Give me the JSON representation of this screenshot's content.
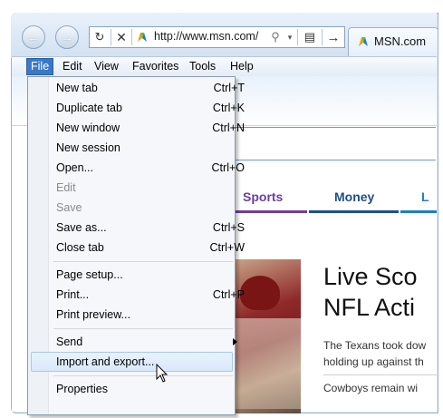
{
  "browser": {
    "url": "http://www.msn.com/",
    "tab_title": "MSN.com"
  },
  "menubar": {
    "items": [
      "File",
      "Edit",
      "View",
      "Favorites",
      "Tools",
      "Help"
    ]
  },
  "file_menu": {
    "items": [
      {
        "label": "New tab",
        "shortcut": "Ctrl+T",
        "enabled": true
      },
      {
        "label": "Duplicate tab",
        "shortcut": "Ctrl+K",
        "enabled": true
      },
      {
        "label": "New window",
        "shortcut": "Ctrl+N",
        "enabled": true
      },
      {
        "label": "New session",
        "shortcut": "",
        "enabled": true
      },
      {
        "label": "Open...",
        "shortcut": "Ctrl+O",
        "enabled": true
      },
      {
        "label": "Edit",
        "shortcut": "",
        "enabled": false
      },
      {
        "label": "Save",
        "shortcut": "",
        "enabled": false
      },
      {
        "label": "Save as...",
        "shortcut": "Ctrl+S",
        "enabled": true
      },
      {
        "label": "Close tab",
        "shortcut": "Ctrl+W",
        "enabled": true
      },
      {
        "label": "Page setup...",
        "shortcut": "",
        "enabled": true
      },
      {
        "label": "Print...",
        "shortcut": "Ctrl+P",
        "enabled": true
      },
      {
        "label": "Print preview...",
        "shortcut": "",
        "enabled": true
      },
      {
        "label": "Send",
        "shortcut": "",
        "enabled": true,
        "submenu": true
      },
      {
        "label": "Import and export...",
        "shortcut": "",
        "enabled": true,
        "highlighted": true
      },
      {
        "label": "Properties",
        "shortcut": "",
        "enabled": true
      }
    ]
  },
  "page": {
    "nav": [
      {
        "label": "Sports",
        "color": "#6b3fa0"
      },
      {
        "label": "Money",
        "color": "#1e4f8c"
      },
      {
        "label": "L",
        "color": "#1e7fbf"
      }
    ],
    "headline_lines": [
      "Live Sco",
      "NFL Acti"
    ],
    "story_lines": [
      "The Texans took dow",
      "holding up against th",
      "Cowboys remain wi"
    ]
  },
  "colors": {
    "menu_highlight": "#3a78c8",
    "hover_item": "#d8e8fb",
    "sports": "#6b3fa0",
    "money": "#1e4f8c"
  }
}
